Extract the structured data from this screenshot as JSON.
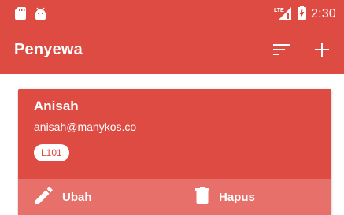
{
  "status_bar": {
    "time": "2:30",
    "network_label": "LTE",
    "icons": [
      "sd-card-icon",
      "android-icon",
      "lte-signal-icon",
      "battery-charging-icon"
    ]
  },
  "app_bar": {
    "title": "Penyewa",
    "actions": [
      "sort-icon",
      "add-icon"
    ]
  },
  "tenant_card": {
    "name": "Anisah",
    "email": "anisah@manykos.co",
    "room": "L101",
    "edit_label": "Ubah",
    "delete_label": "Hapus"
  },
  "colors": {
    "primary": "#dd4b43",
    "card_actions": "#e7716a",
    "text_on_primary": "#ffffff"
  }
}
